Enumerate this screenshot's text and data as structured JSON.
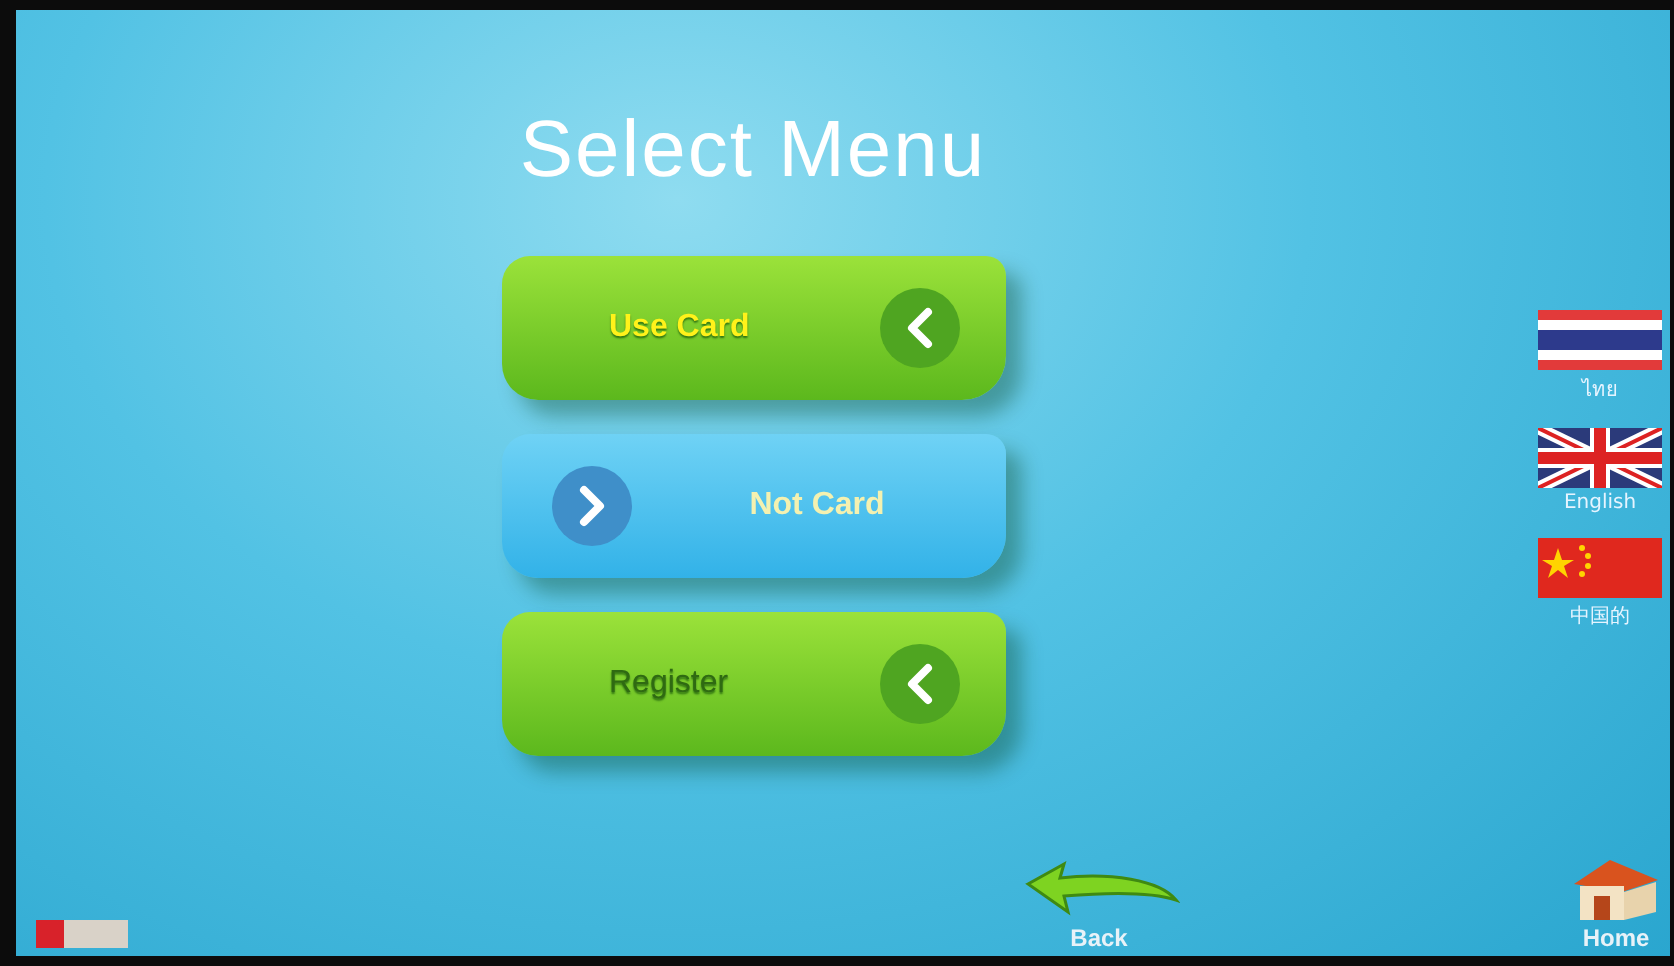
{
  "title": "Select Menu",
  "menu": [
    {
      "label": "Use Card",
      "kind": "green",
      "disabled": false
    },
    {
      "label": "Not Card",
      "kind": "blue",
      "disabled": false
    },
    {
      "label": "Register",
      "kind": "green",
      "disabled": true
    }
  ],
  "languages": [
    {
      "label": "ไทย",
      "kind": "thai"
    },
    {
      "label": "English",
      "kind": "uk"
    },
    {
      "label": "中国的",
      "kind": "china"
    }
  ],
  "nav": [
    {
      "label": "Back",
      "kind": "back"
    },
    {
      "label": "Home",
      "kind": "home"
    }
  ]
}
